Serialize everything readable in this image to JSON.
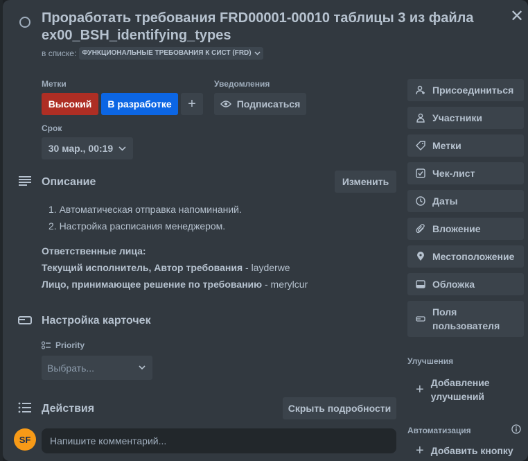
{
  "card": {
    "title": "Проработать требования FRD00001-00010 таблицы 3 из файла ex00_BSH_identifying_types",
    "in_list_prefix": "в списке:",
    "list_name": "ФУНКЦИОНАЛЬНЫЕ ТРЕБОВАНИЯ К СИСТ (FRD)"
  },
  "labels": {
    "heading": "Метки",
    "items": [
      {
        "text": "Высокий",
        "color": "#ae2e24"
      },
      {
        "text": "В разработке",
        "color": "#0c66e4"
      }
    ],
    "add": "+"
  },
  "notifications": {
    "heading": "Уведомления",
    "subscribe": "Подписаться"
  },
  "due": {
    "heading": "Срок",
    "value": "30 мар., 00:19"
  },
  "description": {
    "heading": "Описание",
    "edit": "Изменить",
    "items": [
      "1. Автоматическая отправка напоминаний.",
      "2. Настройка расписания менеджером."
    ],
    "responsible_heading": "Ответственные лица:",
    "line1_bold": "Текущий исполнитель, Автор требования",
    "line1_rest": " - layderwe",
    "line2_bold": "Лицо, принимающее решение по требованию",
    "line2_rest": " - merylcur"
  },
  "custom_fields": {
    "heading": "Настройка карточек",
    "field_label": "Priority",
    "select_placeholder": "Выбрать..."
  },
  "activity": {
    "heading": "Действия",
    "hide_details": "Скрыть подробности",
    "avatar": "SF",
    "comment_placeholder": "Напишите комментарий..."
  },
  "sidebar": {
    "buttons": [
      "Присоединиться",
      "Участники",
      "Метки",
      "Чек-лист",
      "Даты",
      "Вложение",
      "Местоположение",
      "Обложка"
    ],
    "custom_fields": [
      "Поля",
      "пользователя"
    ],
    "powerups_heading": "Улучшения",
    "add_powerup": [
      "Добавление",
      "улучшений"
    ],
    "automation_heading": "Автоматизация",
    "add_button": "Добавить кнопку"
  }
}
